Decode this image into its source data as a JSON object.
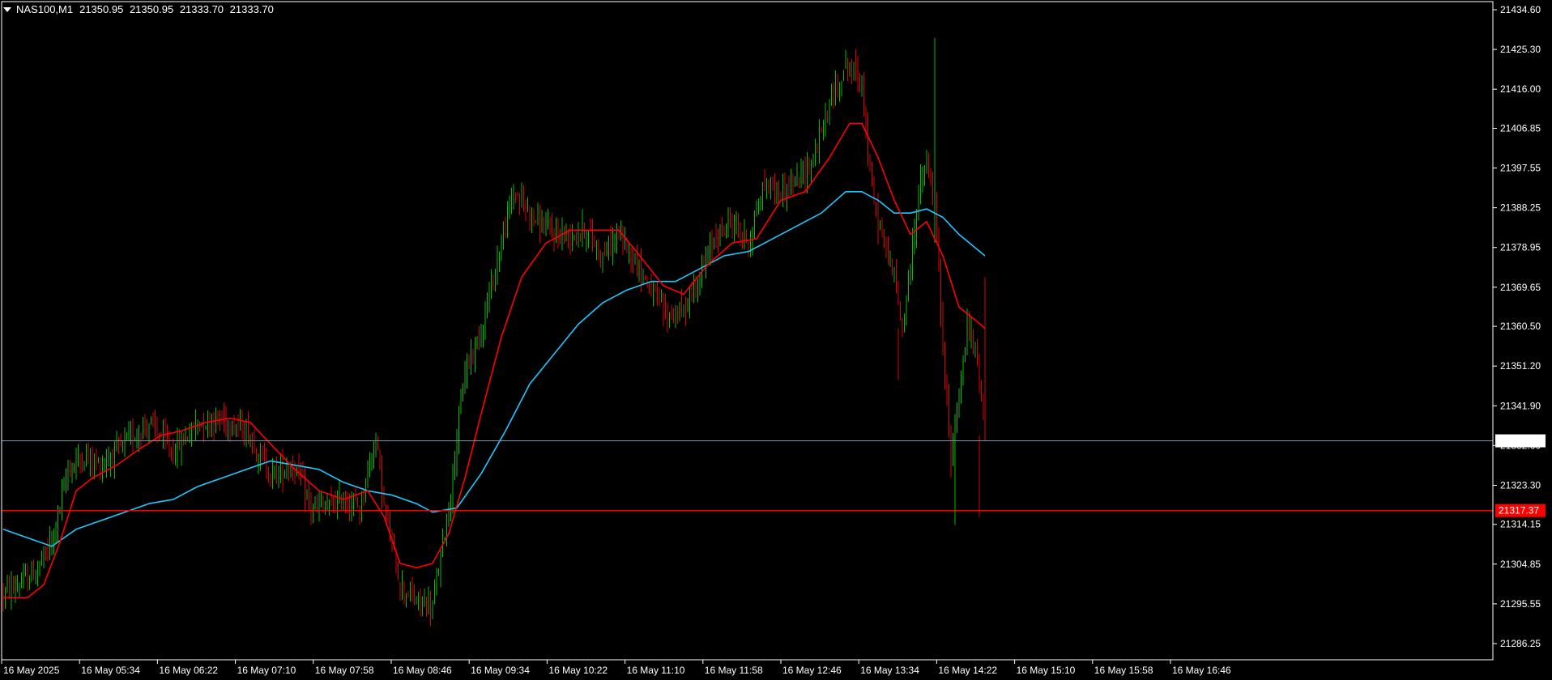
{
  "header": {
    "symbol": "NAS100,M1",
    "open": "21350.95",
    "high": "21350.95",
    "low": "21333.70",
    "close": "21333.70"
  },
  "colors": {
    "background": "#000000",
    "bull": "#00c000",
    "bear": "#e00000",
    "ma_fast": "#ff0000",
    "ma_slow": "#1ec8ff",
    "bid_line": "#7e97a8",
    "level_line": "#ff0000",
    "axis": "#ffffff"
  },
  "chart_data": {
    "type": "candlestick",
    "ylim": [
      21282.0,
      21438.0
    ],
    "yticks": [
      "21434.60",
      "21425.30",
      "21416.00",
      "21406.85",
      "21397.55",
      "21388.25",
      "21378.95",
      "21369.65",
      "21360.50",
      "21351.20",
      "21341.90",
      "21332.60",
      "21323.30",
      "21314.15",
      "21304.85",
      "21295.55",
      "21286.25"
    ],
    "xticks": [
      "16 May 2025",
      "16 May 05:34",
      "16 May 06:22",
      "16 May 07:10",
      "16 May 07:58",
      "16 May 08:46",
      "16 May 09:34",
      "16 May 10:22",
      "16 May 11:10",
      "16 May 11:58",
      "16 May 12:46",
      "16 May 13:34",
      "16 May 14:22",
      "16 May 15:10",
      "16 May 15:58",
      "16 May 16:46"
    ],
    "bid_price": 21333.7,
    "bid_label": "21333.70",
    "level_price": 21317.37,
    "level_label": "21317.37",
    "price_path": [
      [
        0,
        21298
      ],
      [
        20,
        21300
      ],
      [
        40,
        21303
      ],
      [
        60,
        21310
      ],
      [
        80,
        21327
      ],
      [
        100,
        21330
      ],
      [
        120,
        21328
      ],
      [
        150,
        21333
      ],
      [
        180,
        21338
      ],
      [
        210,
        21331
      ],
      [
        240,
        21338
      ],
      [
        270,
        21339
      ],
      [
        300,
        21336
      ],
      [
        330,
        21326
      ],
      [
        360,
        21328
      ],
      [
        380,
        21318
      ],
      [
        400,
        21318
      ],
      [
        420,
        21320
      ],
      [
        440,
        21318
      ],
      [
        460,
        21335
      ],
      [
        470,
        21318
      ],
      [
        490,
        21300
      ],
      [
        510,
        21296
      ],
      [
        530,
        21295
      ],
      [
        550,
        21318
      ],
      [
        570,
        21350
      ],
      [
        590,
        21360
      ],
      [
        610,
        21376
      ],
      [
        630,
        21392
      ],
      [
        660,
        21385
      ],
      [
        680,
        21382
      ],
      [
        700,
        21382
      ],
      [
        720,
        21383
      ],
      [
        740,
        21377
      ],
      [
        760,
        21382
      ],
      [
        780,
        21376
      ],
      [
        800,
        21369
      ],
      [
        820,
        21363
      ],
      [
        840,
        21364
      ],
      [
        860,
        21372
      ],
      [
        880,
        21382
      ],
      [
        900,
        21385
      ],
      [
        920,
        21380
      ],
      [
        940,
        21394
      ],
      [
        960,
        21392
      ],
      [
        980,
        21394
      ],
      [
        1000,
        21400
      ],
      [
        1020,
        21412
      ],
      [
        1040,
        21422
      ],
      [
        1060,
        21418
      ],
      [
        1070,
        21395
      ],
      [
        1080,
        21385
      ],
      [
        1100,
        21372
      ],
      [
        1110,
        21360
      ],
      [
        1120,
        21375
      ],
      [
        1130,
        21392
      ],
      [
        1140,
        21398
      ],
      [
        1150,
        21390
      ],
      [
        1160,
        21355
      ],
      [
        1170,
        21330
      ],
      [
        1180,
        21345
      ],
      [
        1190,
        21360
      ],
      [
        1200,
        21355
      ],
      [
        1210,
        21340
      ],
      [
        1212,
        21333.7
      ]
    ],
    "ma_fast": [
      [
        0,
        21297
      ],
      [
        30,
        21297
      ],
      [
        50,
        21300
      ],
      [
        70,
        21310
      ],
      [
        90,
        21322
      ],
      [
        110,
        21325
      ],
      [
        140,
        21328
      ],
      [
        170,
        21332
      ],
      [
        195,
        21335
      ],
      [
        220,
        21336
      ],
      [
        250,
        21338
      ],
      [
        280,
        21339
      ],
      [
        305,
        21338
      ],
      [
        330,
        21333
      ],
      [
        360,
        21327
      ],
      [
        390,
        21322
      ],
      [
        420,
        21320
      ],
      [
        450,
        21322
      ],
      [
        470,
        21316
      ],
      [
        490,
        21305
      ],
      [
        510,
        21304
      ],
      [
        530,
        21305
      ],
      [
        550,
        21312
      ],
      [
        570,
        21325
      ],
      [
        590,
        21340
      ],
      [
        615,
        21358
      ],
      [
        640,
        21372
      ],
      [
        670,
        21380
      ],
      [
        700,
        21383
      ],
      [
        730,
        21383
      ],
      [
        760,
        21383
      ],
      [
        790,
        21376
      ],
      [
        815,
        21370
      ],
      [
        840,
        21368
      ],
      [
        870,
        21375
      ],
      [
        900,
        21380
      ],
      [
        930,
        21381
      ],
      [
        960,
        21390
      ],
      [
        990,
        21392
      ],
      [
        1020,
        21400
      ],
      [
        1045,
        21408
      ],
      [
        1060,
        21408
      ],
      [
        1080,
        21400
      ],
      [
        1100,
        21390
      ],
      [
        1120,
        21382
      ],
      [
        1140,
        21385
      ],
      [
        1160,
        21377
      ],
      [
        1180,
        21365
      ],
      [
        1200,
        21362
      ],
      [
        1212,
        21360
      ]
    ],
    "ma_slow": [
      [
        0,
        21313
      ],
      [
        30,
        21311
      ],
      [
        60,
        21309
      ],
      [
        90,
        21313
      ],
      [
        120,
        21315
      ],
      [
        150,
        21317
      ],
      [
        180,
        21319
      ],
      [
        210,
        21320
      ],
      [
        240,
        21323
      ],
      [
        270,
        21325
      ],
      [
        300,
        21327
      ],
      [
        330,
        21329
      ],
      [
        360,
        21328
      ],
      [
        390,
        21327
      ],
      [
        420,
        21324
      ],
      [
        450,
        21322
      ],
      [
        480,
        21321
      ],
      [
        510,
        21319
      ],
      [
        530,
        21317
      ],
      [
        560,
        21318
      ],
      [
        590,
        21326
      ],
      [
        620,
        21336
      ],
      [
        650,
        21347
      ],
      [
        680,
        21354
      ],
      [
        710,
        21361
      ],
      [
        740,
        21366
      ],
      [
        770,
        21369
      ],
      [
        800,
        21371
      ],
      [
        830,
        21371
      ],
      [
        860,
        21374
      ],
      [
        890,
        21377
      ],
      [
        920,
        21378
      ],
      [
        950,
        21381
      ],
      [
        980,
        21384
      ],
      [
        1010,
        21387
      ],
      [
        1040,
        21392
      ],
      [
        1060,
        21392
      ],
      [
        1080,
        21390
      ],
      [
        1100,
        21387
      ],
      [
        1120,
        21387
      ],
      [
        1140,
        21388
      ],
      [
        1160,
        21386
      ],
      [
        1180,
        21382
      ],
      [
        1212,
        21377
      ]
    ]
  }
}
